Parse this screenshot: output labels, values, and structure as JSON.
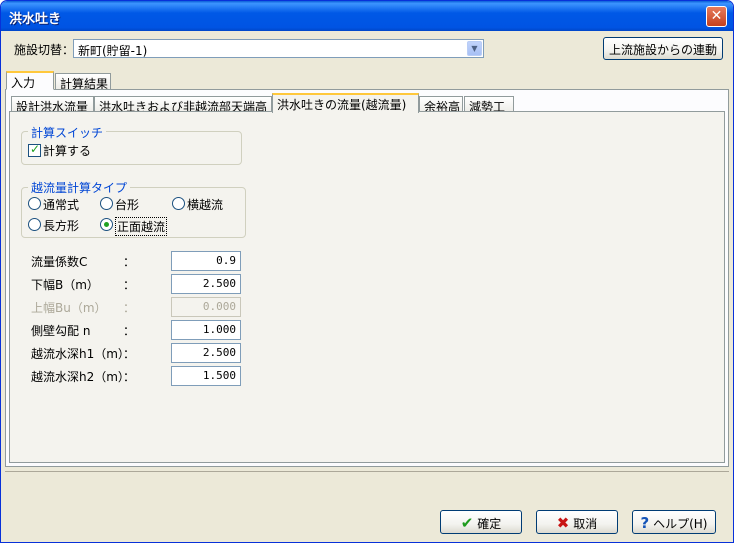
{
  "window": {
    "title": "洪水吐き",
    "close": "✕"
  },
  "facility": {
    "label": "施設切替：",
    "value": "新町(貯留-1)",
    "link_button": "上流施設からの連動"
  },
  "main_tabs": [
    "入力",
    "計算結果"
  ],
  "sub_tabs": [
    "設計洪水流量",
    "洪水吐きおよび非越流部天端高",
    "洪水吐きの流量(越流量)",
    "余裕高",
    "減勢工"
  ],
  "calc_switch": {
    "title": "計算スイッチ",
    "checkbox_label": "計算する",
    "checked": true
  },
  "overflow_type": {
    "title": "越流量計算タイプ",
    "options": [
      "通常式",
      "台形",
      "横越流",
      "長方形",
      "正面越流"
    ],
    "selected": "正面越流"
  },
  "params": [
    {
      "label": "流量係数C",
      "colon": "：",
      "value": "0.9",
      "enabled": true
    },
    {
      "label": "下幅B（m）",
      "colon": "：",
      "value": "2.500",
      "enabled": true
    },
    {
      "label": "上幅Bu（m）",
      "colon": "：",
      "value": "0.000",
      "enabled": false
    },
    {
      "label": "側壁勾配 n",
      "colon": "：",
      "value": "1.000",
      "enabled": true
    },
    {
      "label": "越流水深h1（m）",
      "colon": "：",
      "value": "2.500",
      "enabled": true
    },
    {
      "label": "越流水深h2（m）",
      "colon": "：",
      "value": "1.500",
      "enabled": true
    }
  ],
  "buttons": {
    "ok": "確定",
    "cancel": "取消",
    "help": "ヘルプ(H)"
  },
  "icons": {
    "ok": "check-icon",
    "cancel": "x-icon",
    "help": "question-icon"
  },
  "colors": {
    "title_bar": "#0054e3",
    "active_tab_accent": "#ffc83c",
    "group_title": "#0046d5"
  }
}
